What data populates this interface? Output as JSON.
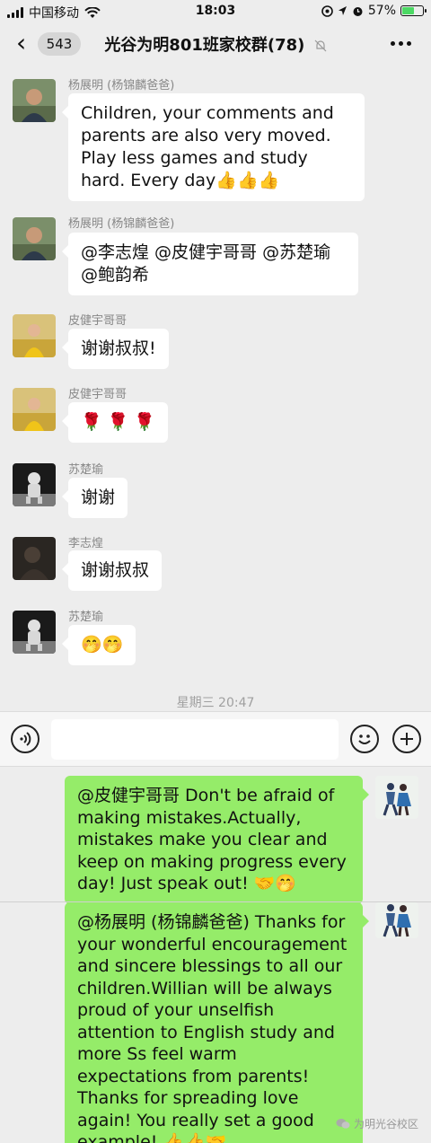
{
  "status_bar": {
    "carrier": "中国移动",
    "time": "18:03",
    "battery": "57%",
    "battery_level": 0.57
  },
  "nav": {
    "back_count": "543",
    "title": "光谷为明801班家校群(78)"
  },
  "messages": [
    {
      "sender": "杨展明 (杨锦麟爸爸)",
      "text": "Children, your comments and parents are also very moved. Play less games and study hard. Every day👍👍👍"
    },
    {
      "sender": "杨展明 (杨锦麟爸爸)",
      "text": "@李志煌 @皮健宇哥哥 @苏楚瑜 @鲍韵希"
    },
    {
      "sender": "皮健宇哥哥",
      "text": "谢谢叔叔!"
    },
    {
      "sender": "皮健宇哥哥",
      "text": "🌹 🌹 🌹"
    },
    {
      "sender": "苏楚瑜",
      "text": "谢谢"
    },
    {
      "sender": "李志煌",
      "text": "谢谢叔叔"
    },
    {
      "sender": "苏楚瑜",
      "text": "🤭🤭"
    }
  ],
  "timestamp": "星期三 20:47",
  "my_messages": [
    {
      "text": "@皮健宇哥哥  Don't be afraid of making mistakes.Actually, mistakes make you clear and keep on making progress every day! Just speak out! 🤝🤭"
    },
    {
      "text": "@杨展明 (杨锦麟爸爸)  Thanks for your wonderful encouragement and sincere blessings to all our children.Willian will be always proud of your unselfish attention to English study and more Ss feel warm expectations from parents! Thanks for spreading love again! You really set a good example! 👍👍🤝"
    }
  ],
  "watermark": "为明光谷校区",
  "icons": [
    "back-chevron-icon",
    "bell-muted-icon",
    "more-icon",
    "voice-icon",
    "emoji-icon",
    "plus-icon",
    "wifi-icon",
    "location-icon",
    "alarm-icon"
  ]
}
